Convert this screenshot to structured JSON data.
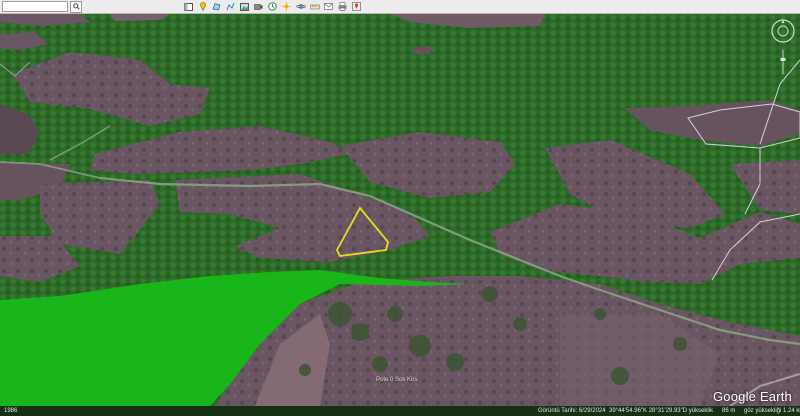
{
  "toolbar": {
    "search_value": "",
    "tools": [
      {
        "name": "hide-sidebar-icon"
      },
      {
        "name": "placemark-icon"
      },
      {
        "name": "polygon-icon"
      },
      {
        "name": "path-icon"
      },
      {
        "name": "image-overlay-icon"
      },
      {
        "name": "tour-icon"
      },
      {
        "name": "historical-imagery-icon"
      },
      {
        "name": "sun-icon"
      },
      {
        "name": "planets-icon"
      },
      {
        "name": "ruler-icon"
      },
      {
        "name": "email-icon"
      },
      {
        "name": "print-icon"
      },
      {
        "name": "google-maps-icon"
      }
    ]
  },
  "map": {
    "label": "Pote 0 Sok Kirs",
    "logo": "Google Earth",
    "scale_label": "1986"
  },
  "status": {
    "imagery_date": "Görüntü Tarihi: 6/29/2024",
    "coordinates": "39°44'54.96\"K 28°31'29.93\"D yükseklik",
    "elevation": "86 m",
    "eye_alt": "göz yüksekliği 1.24 km"
  },
  "colors": {
    "forest": "#2f6b2a",
    "bright_overlay": "#1fc21a",
    "clearing": "#6e5a64",
    "polygon_outline": "#f0e61e",
    "boundary_outline": "#d8dde0"
  }
}
